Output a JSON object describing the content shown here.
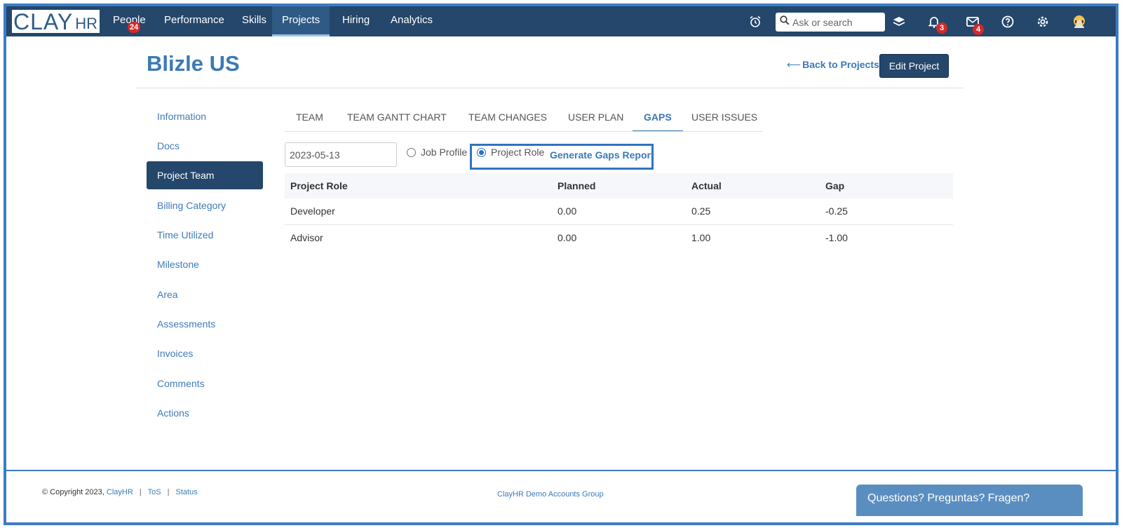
{
  "brand": {
    "name_main": "CLAY",
    "name_sub": "HR"
  },
  "nav": {
    "items": [
      {
        "label": "People",
        "badge": "24"
      },
      {
        "label": "Performance"
      },
      {
        "label": "Skills"
      },
      {
        "label": "Projects"
      },
      {
        "label": "Hiring"
      },
      {
        "label": "Analytics"
      }
    ],
    "search_placeholder": "Ask or search",
    "notifications_badge": "3",
    "messages_badge": "4"
  },
  "header": {
    "title": "Blizle US",
    "back_arrow": "⟵",
    "back_label": "Back to Projects",
    "edit_label": "Edit Project"
  },
  "sidebar": {
    "items": [
      {
        "label": "Information"
      },
      {
        "label": "Docs"
      },
      {
        "label": "Project Team"
      },
      {
        "label": "Billing Category"
      },
      {
        "label": "Time Utilized"
      },
      {
        "label": "Milestone"
      },
      {
        "label": "Area"
      },
      {
        "label": "Assessments"
      },
      {
        "label": "Invoices"
      },
      {
        "label": "Comments"
      },
      {
        "label": "Actions"
      }
    ]
  },
  "tabs": [
    {
      "label": "TEAM"
    },
    {
      "label": "TEAM GANTT CHART"
    },
    {
      "label": "TEAM CHANGES"
    },
    {
      "label": "USER PLAN"
    },
    {
      "label": "GAPS"
    },
    {
      "label": "USER ISSUES"
    }
  ],
  "gaps": {
    "date_value": "2023-05-13",
    "option_job_profile": "Job Profile",
    "option_project_role": "Project Role",
    "generate_label": "Generate Gaps Report",
    "columns": [
      "Project Role",
      "Planned",
      "Actual",
      "Gap"
    ],
    "rows": [
      [
        "Developer",
        "0.00",
        "0.25",
        "-0.25"
      ],
      [
        "Advisor",
        "0.00",
        "1.00",
        "-1.00"
      ]
    ]
  },
  "footer": {
    "copyright": "© Copyright 2023,",
    "clayhr_link": "ClayHR",
    "tos_link": "ToS",
    "status_link": "Status",
    "separator": "|",
    "center_text": "ClayHR Demo Accounts Group",
    "chat_label": "Questions? Preguntas? Fragen?"
  },
  "colors": {
    "nav_bg": "#24476b",
    "accent": "#3b79b5",
    "badge": "#d42a2a"
  }
}
